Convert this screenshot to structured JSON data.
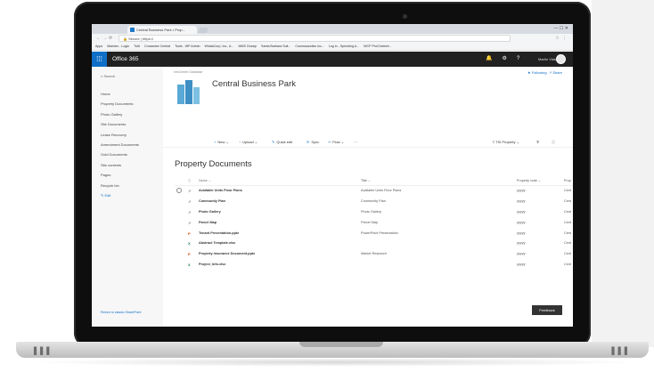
{
  "browser": {
    "tab_title": "Central Business Park • Prop...",
    "address": "Secure | https://",
    "bookmarks": [
      "Apps",
      "Maestro - Login",
      "Tutti",
      "Crosswise Central",
      "Tools - WP Admin",
      "WhatsCorp, Inc., A...",
      "MMS Gossip",
      "Santa Barbara Suit...",
      "Cosmosaurikw Inc...",
      "Log in - Spending A...",
      "WCP Pro/Celebrit..."
    ]
  },
  "suite": {
    "waffle_icon": "waffle-icon",
    "title": "Office 365",
    "user_name": "Martin Vlak"
  },
  "leftnav": {
    "search": "Search",
    "items": [
      "Home",
      "Property Documents",
      "Photo Gallery",
      "Site Documents",
      "Lease Recovery",
      "Amendment Documents",
      "Gold Documents",
      "Site contents",
      "Pages",
      "Recycle bin"
    ],
    "edit": "Edit",
    "return_link": "Return to classic SharePoint"
  },
  "site": {
    "breadcrumb": "InfoCenter Database",
    "title": "Central Business Park",
    "follow": "Following",
    "share": "Share",
    "logo_color": "#5aa9d6"
  },
  "commands": {
    "new": "New",
    "upload": "Upload",
    "quick_edit": "Quick edit",
    "sync": "Sync",
    "flow": "Flow",
    "more": "···",
    "view": "TSI Property"
  },
  "library": {
    "title": "Property Documents",
    "columns": {
      "name": "Name",
      "title": "Title",
      "property_code": "Property code",
      "property": "Prop"
    },
    "rows": [
      {
        "type": "link",
        "name": "Available Units Floor Plans",
        "title": "Available Units Floor Plans",
        "code": "yyyyy",
        "prop": "Cent"
      },
      {
        "type": "link",
        "name": "Community Plan",
        "title": "Community Plan",
        "code": "yyyyy",
        "prop": "Cent"
      },
      {
        "type": "link",
        "name": "Photo Gallery",
        "title": "Photo Gallery",
        "code": "yyyyy",
        "prop": "Cent"
      },
      {
        "type": "link",
        "name": "Parcel Map",
        "title": "Parcel Map",
        "code": "yyyyy",
        "prop": "Cent"
      },
      {
        "type": "doc",
        "name": "Tenant Presentation.pptx",
        "title": "PowerPoint Presentation",
        "code": "yyyyy",
        "prop": "Cent"
      },
      {
        "type": "xls",
        "name": "Abstract Template.xlsx",
        "title": "",
        "code": "yyyyy",
        "prop": "Cent"
      },
      {
        "type": "doc",
        "name": "Property Insurance Document.pptx",
        "title": "Market Research",
        "code": "yyyyy",
        "prop": "Cent"
      },
      {
        "type": "xls",
        "name": "Project_Info.xlsx",
        "title": "",
        "code": "yyyyy",
        "prop": "Cent"
      }
    ]
  },
  "feedback": "Feedback"
}
